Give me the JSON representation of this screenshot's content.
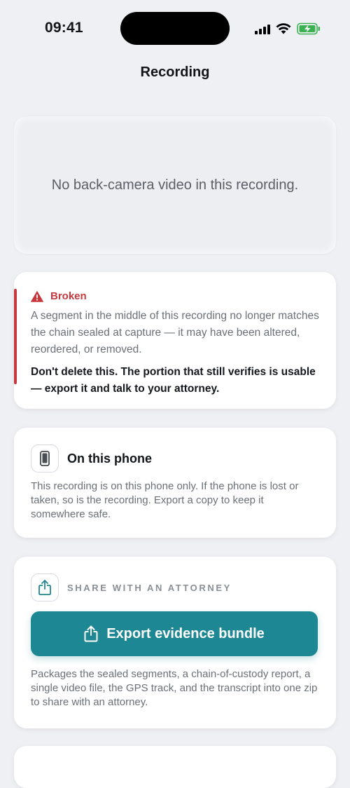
{
  "status_bar": {
    "time": "09:41"
  },
  "nav": {
    "title": "Recording"
  },
  "video": {
    "message": "No back-camera video in this recording."
  },
  "integrity": {
    "status": "Broken",
    "description": "A segment in the middle of this recording no longer matches the chain sealed at capture — it may have been altered, reordered, or removed.",
    "advice": "Don't delete this. The portion that still verifies is usable — export it and talk to your attorney.",
    "accent_color": "#c6383d"
  },
  "storage": {
    "title": "On this phone",
    "description": "This recording is on this phone only. If the phone is lost or taken, so is the recording. Export a copy to keep it somewhere safe."
  },
  "share": {
    "section_label": "SHARE WITH AN ATTORNEY",
    "button_label": "Export evidence bundle",
    "description": "Packages the sealed segments, a chain-of-custody report, a single video file, the GPS track, and the transcript into one zip to share with an attorney.",
    "accent_color": "#1d8794"
  }
}
